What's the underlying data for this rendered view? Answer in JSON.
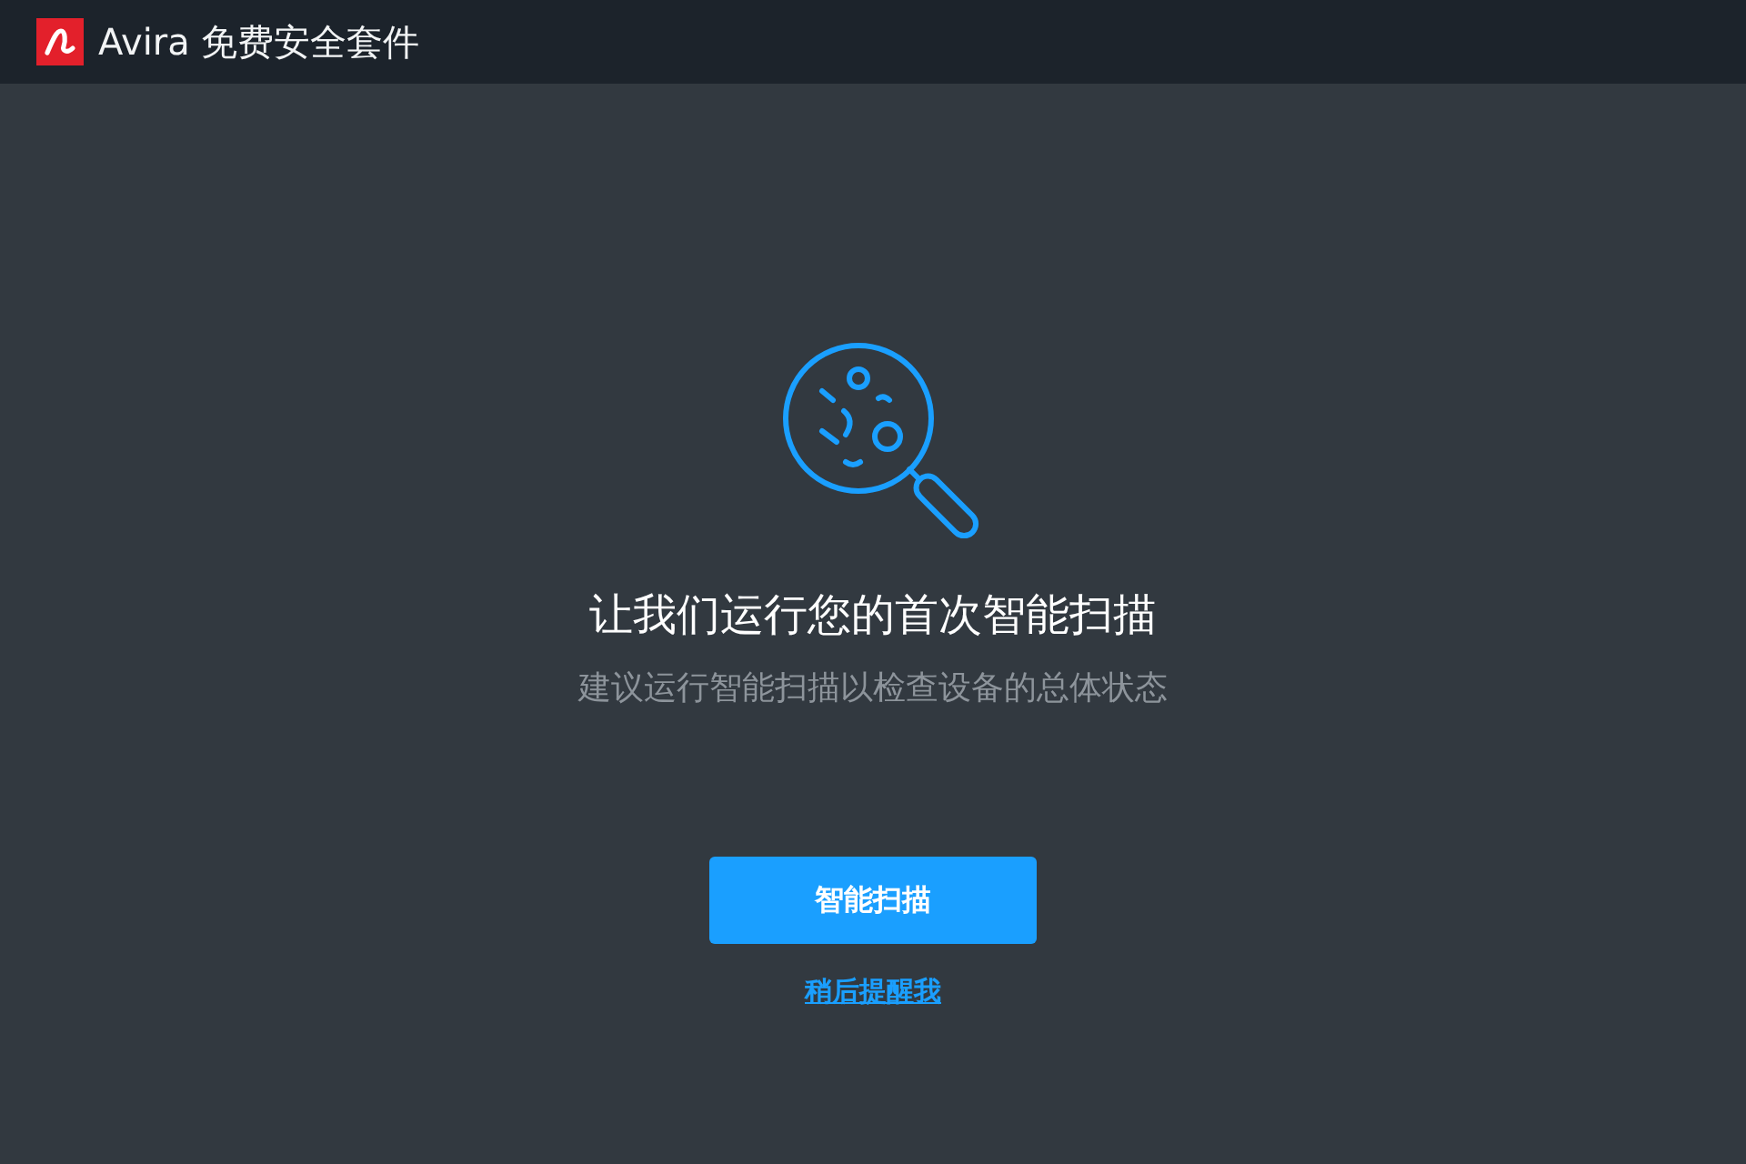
{
  "window": {
    "title": "Avira 免费安全套件"
  },
  "prompt": {
    "heading": "让我们运行您的首次智能扫描",
    "subtitle": "建议运行智能扫描以检查设备的总体状态"
  },
  "actions": [
    {
      "kind": "primary",
      "label": "智能扫描"
    },
    {
      "kind": "link",
      "label": "稍后提醒我"
    }
  ]
}
